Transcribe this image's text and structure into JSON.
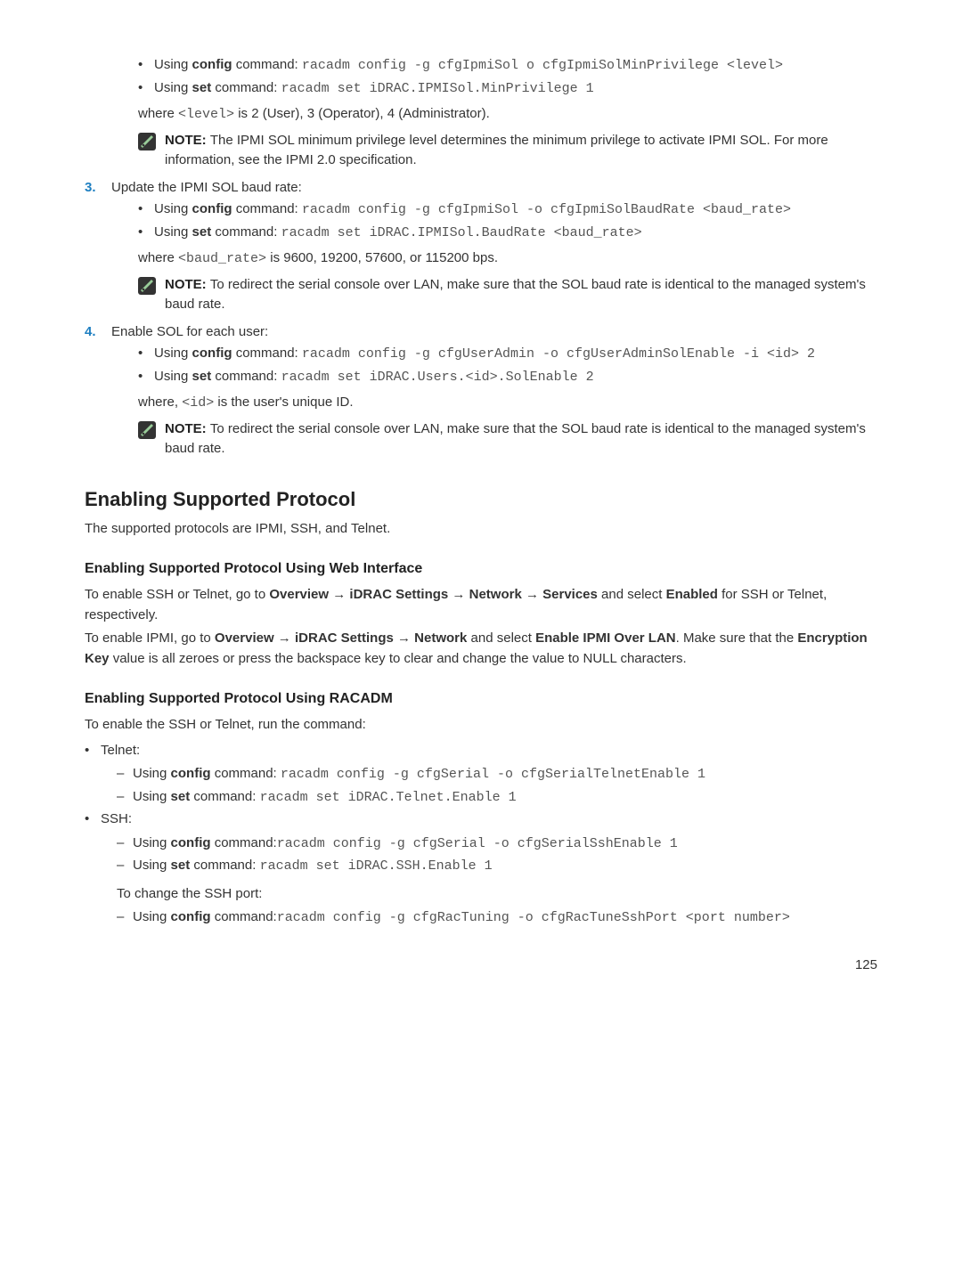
{
  "step2": {
    "i1_prefix": "Using ",
    "i1_cmd": "config",
    "i1_mid": " command: ",
    "i1_code": "racadm config -g cfgIpmiSol o cfgIpmiSolMinPrivilege <level>",
    "i2_prefix": "Using ",
    "i2_cmd": "set",
    "i2_mid": " command: ",
    "i2_code": "racadm set iDRAC.IPMISol.MinPrivilege 1",
    "where_a": "where ",
    "where_code": "<level>",
    "where_b": " is 2 (User), 3 (Operator), 4 (Administrator).",
    "note": "The IPMI SOL minimum privilege level determines the minimum privilege to activate IPMI SOL. For more information, see the IPMI 2.0 specification."
  },
  "step3": {
    "num": "3.",
    "title": "Update the IPMI SOL baud rate:",
    "i1_prefix": "Using ",
    "i1_cmd": "config",
    "i1_mid": " command: ",
    "i1_code": "racadm config -g cfgIpmiSol -o cfgIpmiSolBaudRate <baud_rate>",
    "i2_prefix": "Using ",
    "i2_cmd": "set",
    "i2_mid": " command: ",
    "i2_code": "racadm set iDRAC.IPMISol.BaudRate <baud_rate>",
    "where_a": "where ",
    "where_code": "<baud_rate>",
    "where_b": " is 9600, 19200, 57600, or 115200 bps.",
    "note": "To redirect the serial console over LAN, make sure that the SOL baud rate is identical to the managed system's baud rate."
  },
  "step4": {
    "num": "4.",
    "title": "Enable SOL for each user:",
    "i1_prefix": "Using ",
    "i1_cmd": "config",
    "i1_mid": " command: ",
    "i1_code": "racadm config -g cfgUserAdmin -o cfgUserAdminSolEnable -i <id> 2",
    "i2_prefix": "Using ",
    "i2_cmd": "set",
    "i2_mid": " command: ",
    "i2_code": "racadm set iDRAC.Users.<id>.SolEnable 2",
    "where_a": "where, ",
    "where_code": "<id>",
    "where_b": " is the user's unique ID.",
    "note": "To redirect the serial console over LAN, make sure that the SOL baud rate is identical to the managed system's baud rate."
  },
  "note_label": "NOTE: ",
  "section": {
    "title": "Enabling Supported Protocol",
    "intro": "The supported protocols are IPMI, SSH, and Telnet."
  },
  "web": {
    "title": "Enabling Supported Protocol Using Web Interface",
    "p1_a": "To enable SSH or Telnet, go to ",
    "p1_b": "Overview",
    "p1_c": " → ",
    "p1_d": "iDRAC Settings",
    "p1_e": " → ",
    "p1_f": "Network",
    "p1_g": " → ",
    "p1_h": "Services",
    "p1_i": " and select ",
    "p1_j": "Enabled",
    "p1_k": " for SSH or Telnet, respectively.",
    "p2_a": "To enable IPMI, go to ",
    "p2_b": "Overview",
    "p2_c": " → ",
    "p2_d": "iDRAC Settings",
    "p2_e": " → ",
    "p2_f": "Network",
    "p2_g": " and select ",
    "p2_h": "Enable IPMI Over LAN",
    "p2_i": ". Make sure that the ",
    "p2_j": "Encryption Key",
    "p2_k": " value is all zeroes or press the backspace key to clear and change the value to NULL characters."
  },
  "racadm": {
    "title": "Enabling Supported Protocol Using RACADM",
    "intro": "To enable the SSH or Telnet, run the command:",
    "telnet_label": "Telnet:",
    "tel_i1_prefix": "Using ",
    "tel_i1_cmd": "config",
    "tel_i1_mid": " command: ",
    "tel_i1_code": "racadm config -g cfgSerial -o cfgSerialTelnetEnable 1",
    "tel_i2_prefix": "Using ",
    "tel_i2_cmd": "set",
    "tel_i2_mid": " command: ",
    "tel_i2_code": "racadm set iDRAC.Telnet.Enable 1",
    "ssh_label": "SSH:",
    "ssh_i1_prefix": "Using ",
    "ssh_i1_cmd": "config",
    "ssh_i1_mid": " command:",
    "ssh_i1_code": "racadm config -g cfgSerial -o cfgSerialSshEnable 1",
    "ssh_i2_prefix": "Using ",
    "ssh_i2_cmd": "set",
    "ssh_i2_mid": " command: ",
    "ssh_i2_code": "racadm set iDRAC.SSH.Enable 1",
    "ssh_port": "To change the SSH port:",
    "ssh_p_prefix": "Using ",
    "ssh_p_cmd": "config",
    "ssh_p_mid": " command:",
    "ssh_p_code": "racadm config -g cfgRacTuning -o cfgRacTuneSshPort <port number>"
  },
  "pagenum": "125"
}
